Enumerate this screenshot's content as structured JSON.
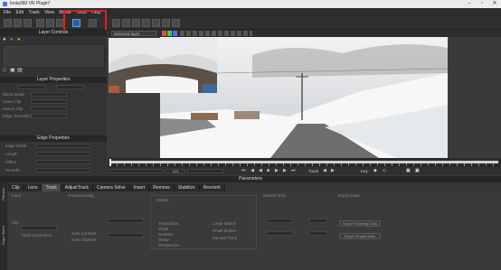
{
  "window": {
    "title": "Insta360 VR Plugin*"
  },
  "menu": [
    "File",
    "Edit",
    "Track",
    "View",
    "Movie",
    "Tools",
    "Help"
  ],
  "viewer_bar": {
    "layer_select": "Selected layer"
  },
  "layer_controls": {
    "title": "Layer Controls"
  },
  "layer_properties": {
    "title": "Layer Properties",
    "labels": [
      "Blend Mode",
      "Invert Clip",
      "Motion Clip",
      "Edge Smoothing"
    ]
  },
  "edge_properties": {
    "title": "Edge Properties",
    "labels": [
      "Edge Width",
      "Length",
      "Offset",
      "Smooth"
    ]
  },
  "timeline": {
    "frame": "113",
    "track_label": "Track",
    "key_label": "Key"
  },
  "params": {
    "title": "Parameters",
    "tabs": [
      "Clip",
      "Lens",
      "Track",
      "AdjustTrack",
      "Camera Solve",
      "Insert",
      "Remove",
      "Stabilize",
      "Reorient"
    ],
    "active_tab": "Track",
    "side_tab": "Dope Sheet",
    "side_tab2": "Params",
    "groups": [
      "Input",
      "Preprocessing",
      "Motion",
      "Search Area",
      "Export Data"
    ],
    "input_labels": [
      "Clip",
      "Track Luminance",
      "Auto Contrast",
      "Auto Channel"
    ],
    "motion_options": [
      "Translation",
      "Scale",
      "Rotation",
      "Shear",
      "Perspective"
    ],
    "search_options": [
      "Large Motion",
      "Small Motion",
      "Manual Track"
    ],
    "export_buttons": [
      "Export Tracking Data",
      "Export Shape Data"
    ]
  },
  "colors": {
    "accent": "#2d5f9a",
    "highlight": "#e02020",
    "timeline_track": "#d0d0d0"
  }
}
